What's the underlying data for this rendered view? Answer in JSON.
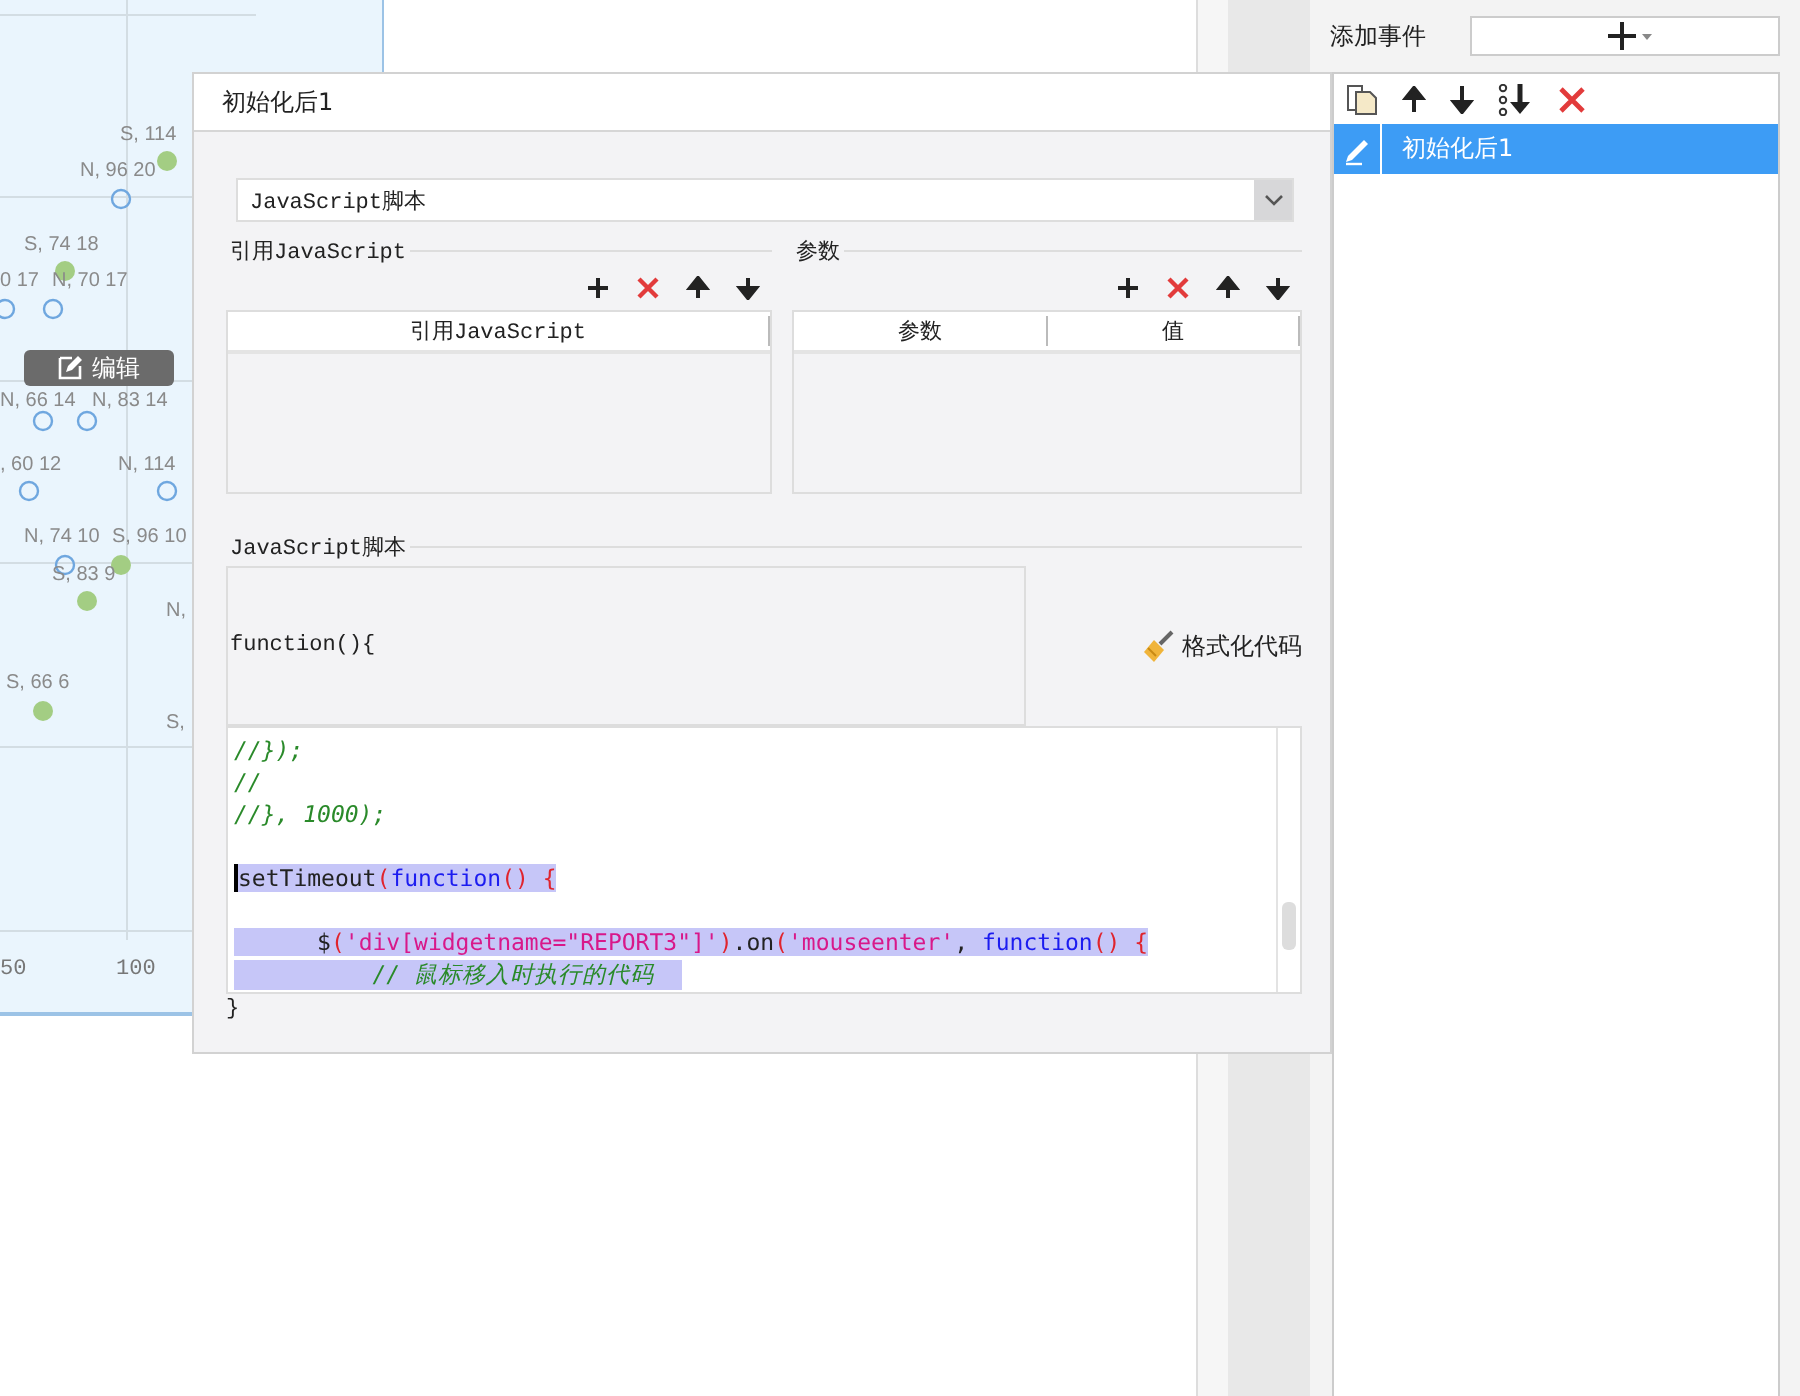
{
  "chart_panel": {
    "points": [
      {
        "label": "S, 114",
        "kind": "filled"
      },
      {
        "label": "N, 96 20",
        "kind": "hollow"
      },
      {
        "label": "S, 74 18",
        "kind": "filled"
      },
      {
        "label": "0 17",
        "kind": "hollow"
      },
      {
        "label": "N, 70 17",
        "kind": "hollow"
      },
      {
        "label": "N, 66 14",
        "kind": "hollow"
      },
      {
        "label": "N, 83 14",
        "kind": "hollow"
      },
      {
        "label": ", 60 12",
        "kind": "hollow"
      },
      {
        "label": "N, 114",
        "kind": "hollow"
      },
      {
        "label": "N, 74 10",
        "kind": "hollow"
      },
      {
        "label": "S, 96 10",
        "kind": "filled"
      },
      {
        "label": "S, 83 9",
        "kind": "filled"
      },
      {
        "label": "N,",
        "kind": "text"
      },
      {
        "label": "S, 66 6",
        "kind": "filled"
      },
      {
        "label": "S,",
        "kind": "text"
      }
    ],
    "axis_labels": [
      "50",
      "100"
    ],
    "edit_button": {
      "label": "编辑"
    }
  },
  "dialog": {
    "title": "初始化后1",
    "type_select": {
      "value": "JavaScript脚本"
    },
    "imports": {
      "title": "引用JavaScript",
      "columns": [
        "引用JavaScript"
      ]
    },
    "params": {
      "title": "参数",
      "columns": [
        "参数",
        "值"
      ]
    },
    "script": {
      "title": "JavaScript脚本",
      "header": "function(){",
      "format_button": "格式化代码",
      "lines": [
        {
          "kind": "code",
          "selected": false,
          "tokens": [
            {
              "kind": "comment",
              "text": "//});"
            }
          ]
        },
        {
          "kind": "code",
          "selected": false,
          "tokens": [
            {
              "kind": "comment",
              "text": "//"
            }
          ]
        },
        {
          "kind": "code",
          "selected": false,
          "tokens": [
            {
              "kind": "comment",
              "text": "//}, 1000);"
            }
          ]
        },
        {
          "kind": "blank"
        },
        {
          "kind": "code",
          "selected": true,
          "caret": true,
          "tokens": [
            {
              "kind": "plain",
              "text": "setTimeout"
            },
            {
              "kind": "punct",
              "text": "("
            },
            {
              "kind": "keyword",
              "text": "function"
            },
            {
              "kind": "punct",
              "text": "() {"
            }
          ]
        },
        {
          "kind": "blank"
        },
        {
          "kind": "code",
          "selected": true,
          "tokens": [
            {
              "kind": "plain",
              "text": "      $"
            },
            {
              "kind": "punct",
              "text": "("
            },
            {
              "kind": "string",
              "text": "'div[widgetname=\"REPORT3\"]'"
            },
            {
              "kind": "punct",
              "text": ")"
            },
            {
              "kind": "plain",
              "text": ".on"
            },
            {
              "kind": "punct",
              "text": "("
            },
            {
              "kind": "string",
              "text": "'mouseenter'"
            },
            {
              "kind": "plain",
              "text": ", "
            },
            {
              "kind": "keyword",
              "text": "function"
            },
            {
              "kind": "punct",
              "text": "() {"
            }
          ]
        },
        {
          "kind": "code",
          "selected": true,
          "tokens": [
            {
              "kind": "comment",
              "text": "          // 鼠标移入时执行的代码  "
            }
          ]
        }
      ],
      "footer": "}"
    }
  },
  "events_panel": {
    "label": "添加事件",
    "items": [
      {
        "label": "初始化后1",
        "selected": true
      }
    ]
  }
}
